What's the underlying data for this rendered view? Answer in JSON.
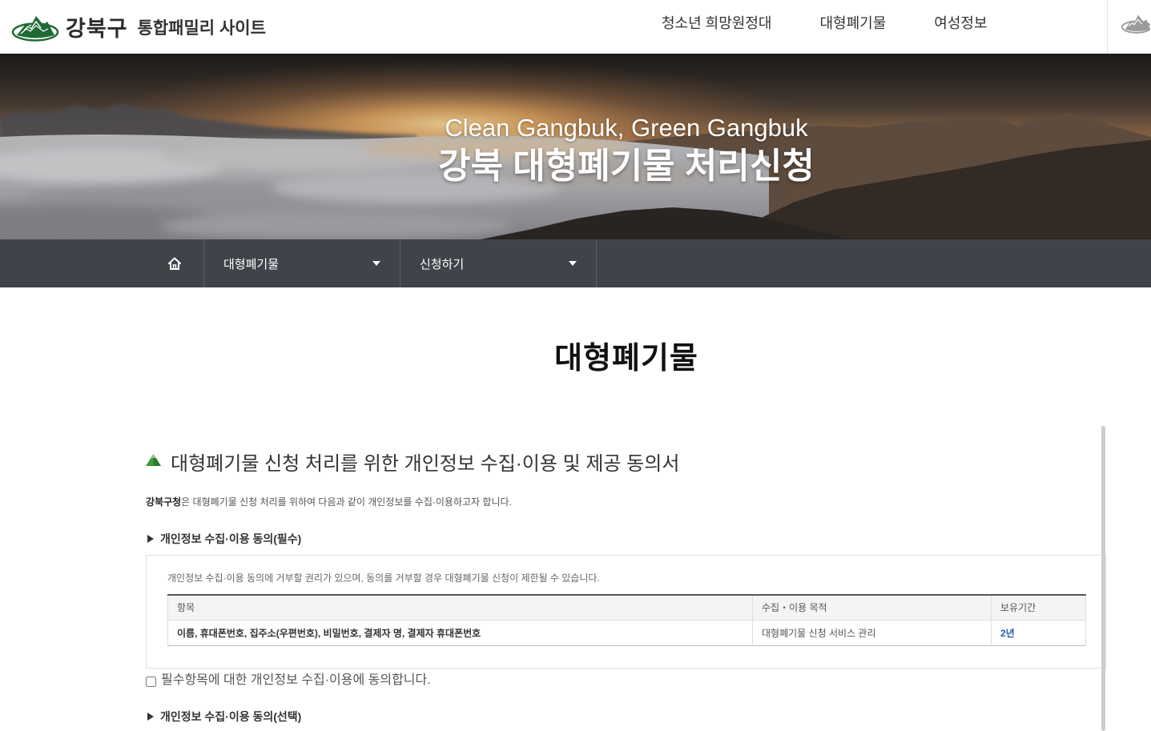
{
  "header": {
    "logo_icon": "gangbuk-logo-icon",
    "logo_text": "강북구",
    "site_name": "통합패밀리 사이트",
    "nav": [
      {
        "label": "청소년 희망원정대"
      },
      {
        "label": "대형폐기물"
      },
      {
        "label": "여성정보"
      }
    ],
    "family_site_icon": "mountain-icon"
  },
  "hero": {
    "slogan": "Clean Gangbuk, Green Gangbuk",
    "title": "강북 대형폐기물 처리신청"
  },
  "breadcrumb": {
    "home_icon": "home-icon",
    "menus": [
      {
        "label": "대형폐기물",
        "icon": "caret-down-icon"
      },
      {
        "label": "신청하기",
        "icon": "caret-down-icon"
      }
    ]
  },
  "page_title": "대형폐기물",
  "consent": {
    "heading_icon": "green-mountain-icon",
    "heading": "대형폐기물 신청 처리를 위한 개인정보 수집·이용 및 제공 동의서",
    "intro": {
      "organization": "강북구청",
      "text": "은 대형폐기물 신청 처리를 위하여 다음과 같이 개인정보를 수집·이용하고자 합니다."
    },
    "required": {
      "bullet_icon": "triangle-right-icon",
      "title": "개인정보 수집·이용 동의(필수)",
      "notice": "개인정보 수집·이용 동의에 거부할 권리가 있으며, 동의를 거부할 경우 대형폐기물 신청이 제한될 수 있습니다.",
      "table": {
        "headers": [
          "항목",
          "수집・이용 목적",
          "보유기간"
        ],
        "rows": [
          [
            "이름, 휴대폰번호, 집주소(우편번호), 비밀번호, 결제자 명, 결제자 휴대폰번호",
            "대형폐기물 신청 서비스 관리",
            "2년"
          ]
        ]
      },
      "agree_label": "필수항목에 대한 개인정보 수집·이용에 동의합니다.",
      "agree_checked": false
    },
    "optional": {
      "bullet_icon": "triangle-right-icon",
      "title": "개인정보 수집·이용 동의(선택)"
    }
  },
  "colors": {
    "brand_green": "#1f6a33",
    "section_icon_green": "#3f9a3a",
    "breadcrumb_bg": "#3e4449",
    "period_blue": "#1d5fa8",
    "table_header_bg": "#f4f4f4"
  }
}
